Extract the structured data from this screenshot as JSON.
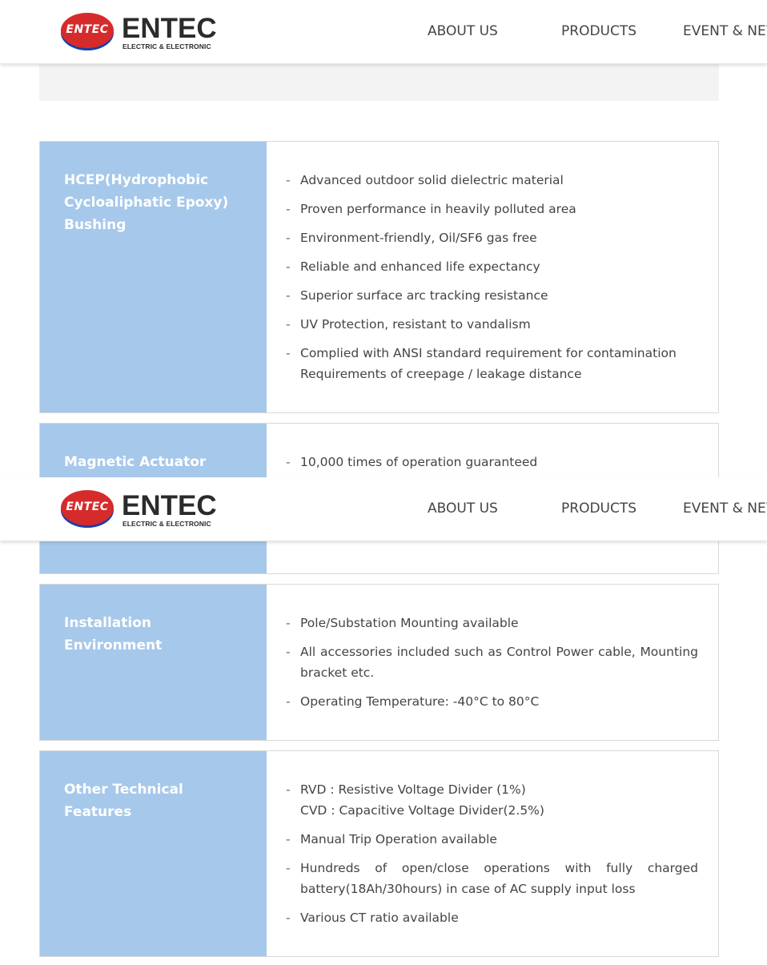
{
  "header": {
    "logo_badge_text": "ENTEC",
    "logo_word": "ENTEC",
    "logo_sub": "ELECTRIC & ELECTRONIC",
    "nav": [
      "ABOUT US",
      "PRODUCTS",
      "EVENT & NEWS"
    ]
  },
  "colors": {
    "label_column": "#a6c8ea",
    "logo_red": "#d62b2b",
    "logo_blue": "#1c3fa8"
  },
  "features": [
    {
      "title": "HCEP(Hydrophobic Cycloaliphatic Epoxy) Bushing",
      "items": [
        {
          "lines": [
            "Advanced outdoor solid dielectric material"
          ]
        },
        {
          "lines": [
            "Proven performance in heavily polluted area"
          ]
        },
        {
          "lines": [
            "Environment-friendly, Oil/SF6 gas free"
          ]
        },
        {
          "lines": [
            "Reliable and enhanced life expectancy"
          ]
        },
        {
          "lines": [
            "Superior surface arc tracking resistance"
          ]
        },
        {
          "lines": [
            "UV Protection, resistant to vandalism"
          ]
        },
        {
          "lines": [
            "Complied with ANSI standard requirement for contamination",
            "Requirements of creepage / leakage distance"
          ]
        }
      ]
    },
    {
      "title": "Magnetic Actuator",
      "items": [
        {
          "lines": [
            "10,000 times of operation guaranteed"
          ]
        }
      ]
    },
    {
      "title": "Installation Environment",
      "items": [
        {
          "lines": [
            "Pole/Substation Mounting available"
          ]
        },
        {
          "lines": [
            "All accessories included such as Control Power cable, Mounting bracket etc."
          ]
        },
        {
          "lines": [
            "Operating Temperature: -40°C to 80°C"
          ]
        }
      ]
    },
    {
      "title": "Other Technical Features",
      "items": [
        {
          "lines": [
            "RVD : Resistive Voltage Divider (1%)",
            "CVD : Capacitive Voltage Divider(2.5%)"
          ]
        },
        {
          "lines": [
            "Manual Trip Operation available"
          ]
        },
        {
          "lines": [
            "Hundreds of open/close operations with fully charged battery(18Ah/30hours) in case of AC supply input loss"
          ]
        },
        {
          "lines": [
            "Various CT ratio available"
          ]
        }
      ]
    }
  ]
}
